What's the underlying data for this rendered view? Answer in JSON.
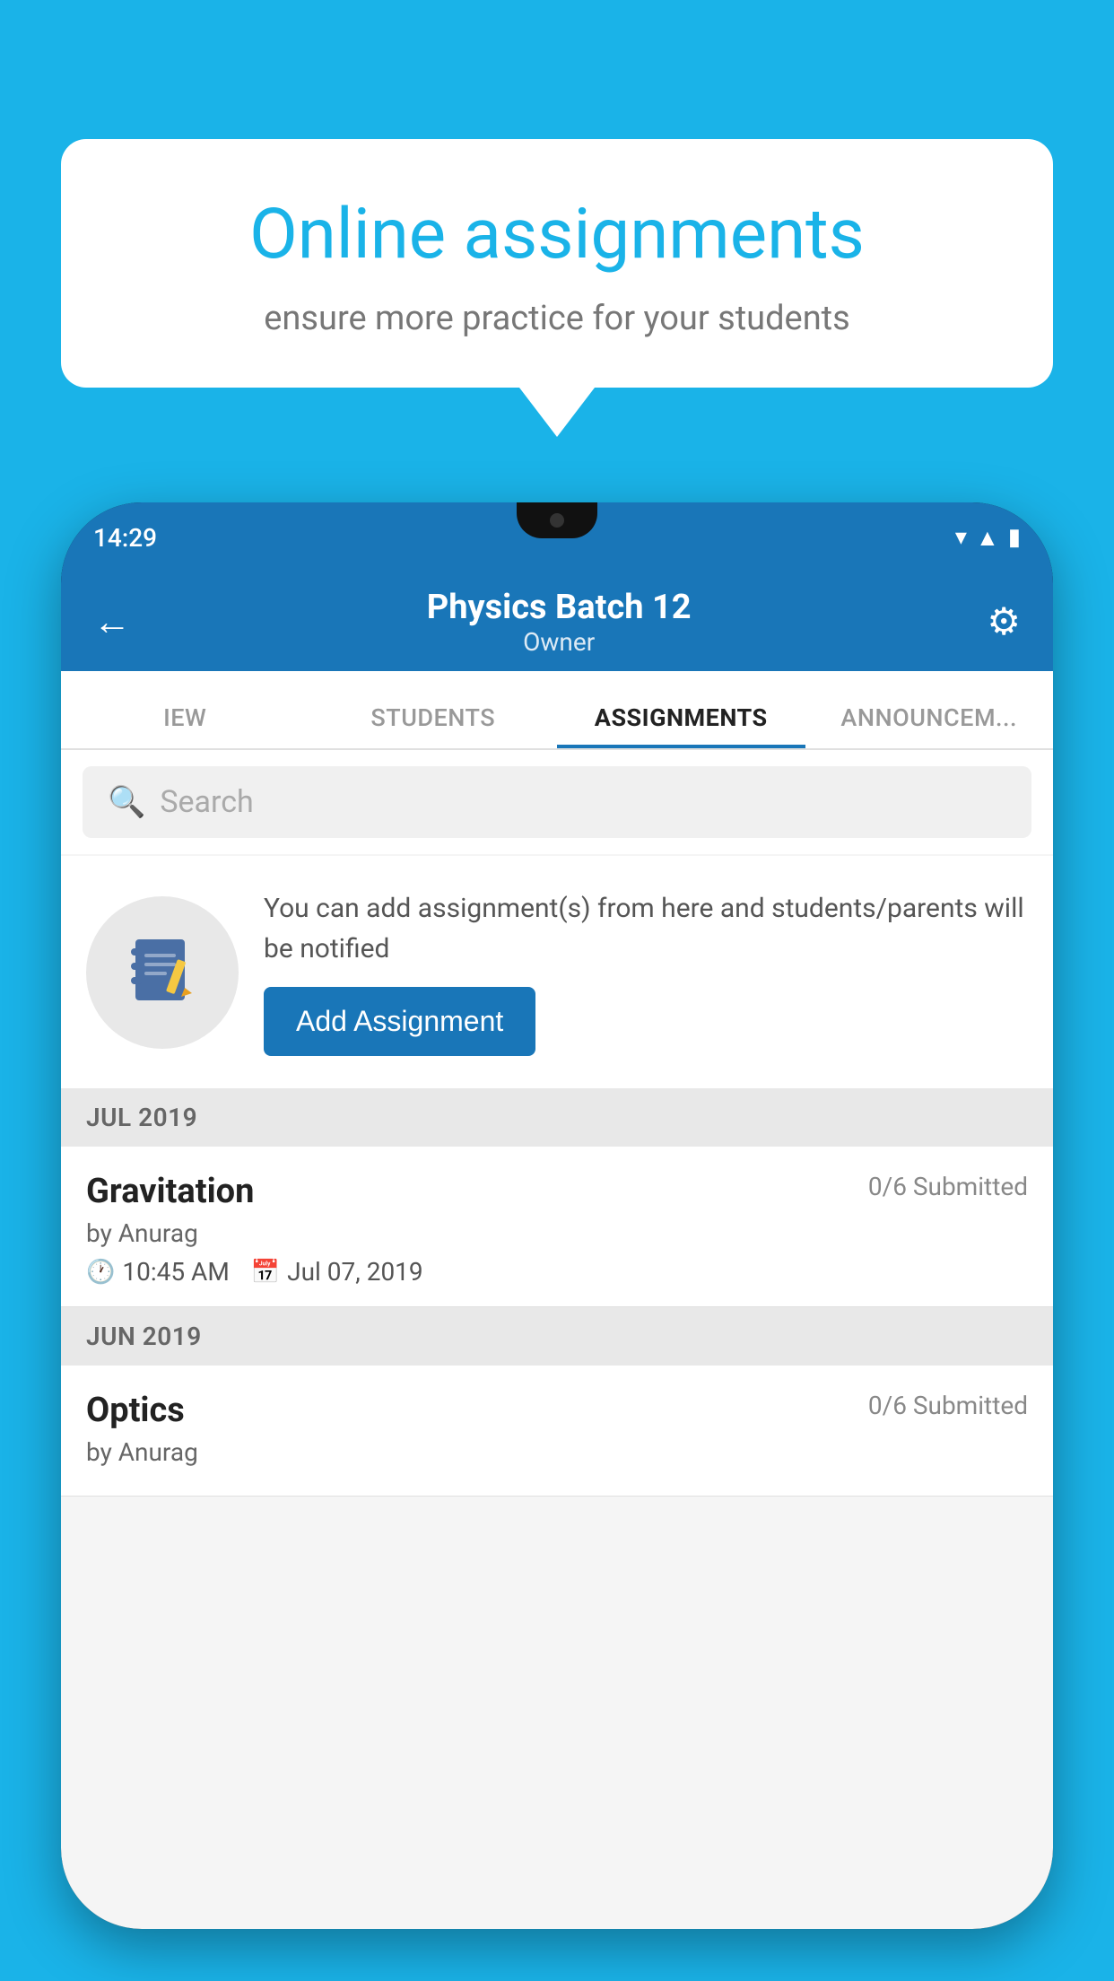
{
  "background_color": "#1ab3e8",
  "speech_bubble": {
    "title": "Online assignments",
    "subtitle": "ensure more practice for your students"
  },
  "status_bar": {
    "time": "14:29",
    "icons": [
      "wifi",
      "signal",
      "battery"
    ]
  },
  "header": {
    "title": "Physics Batch 12",
    "subtitle": "Owner"
  },
  "tabs": [
    {
      "label": "IEW",
      "active": false
    },
    {
      "label": "STUDENTS",
      "active": false
    },
    {
      "label": "ASSIGNMENTS",
      "active": true
    },
    {
      "label": "ANNOUNCEM...",
      "active": false
    }
  ],
  "search": {
    "placeholder": "Search"
  },
  "promo": {
    "description": "You can add assignment(s) from here and students/parents will be notified",
    "button_label": "Add Assignment"
  },
  "sections": [
    {
      "month_label": "JUL 2019",
      "assignments": [
        {
          "title": "Gravitation",
          "submitted": "0/6 Submitted",
          "author": "by Anurag",
          "time": "10:45 AM",
          "date": "Jul 07, 2019"
        }
      ]
    },
    {
      "month_label": "JUN 2019",
      "assignments": [
        {
          "title": "Optics",
          "submitted": "0/6 Submitted",
          "author": "by Anurag",
          "time": "",
          "date": ""
        }
      ]
    }
  ],
  "icons": {
    "back_arrow": "←",
    "gear": "⚙",
    "search": "🔍",
    "clock": "🕐",
    "calendar": "📅",
    "notebook": "📓"
  }
}
